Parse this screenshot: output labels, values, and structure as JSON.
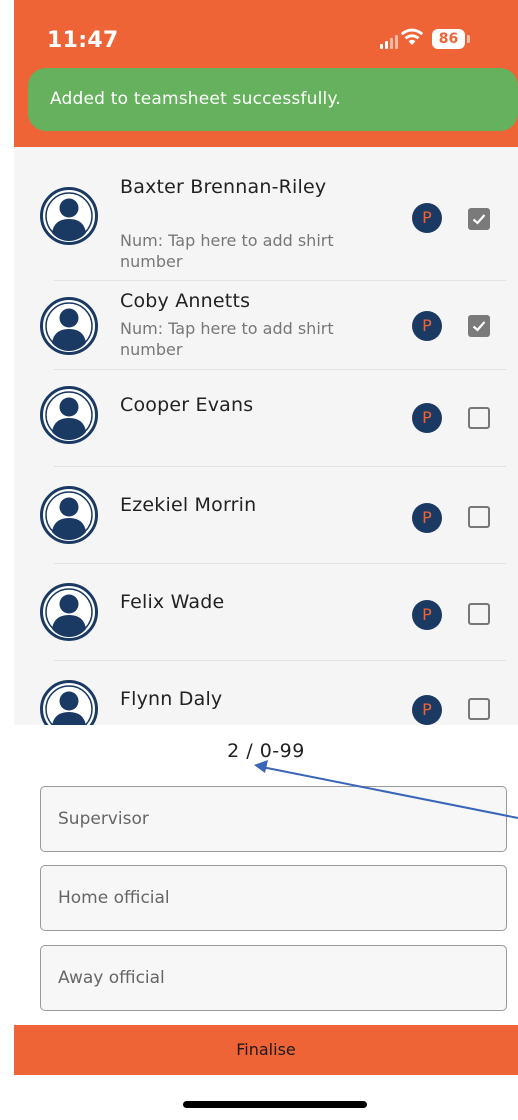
{
  "status_bar": {
    "time": "11:47",
    "battery": "86",
    "icons": [
      "signal-icon",
      "wifi-icon",
      "battery-icon"
    ]
  },
  "toast": {
    "message": "Added to teamsheet successfully."
  },
  "players": [
    {
      "name": "Baxter Brennan-Riley",
      "number_hint": "Num: Tap here to add shirt number",
      "badge": "P",
      "checked": true
    },
    {
      "name": "Coby Annetts",
      "number_hint": "Num: Tap here to add shirt number",
      "badge": "P",
      "checked": true
    },
    {
      "name": "Cooper Evans",
      "number_hint": "",
      "badge": "P",
      "checked": false
    },
    {
      "name": "Ezekiel Morrin",
      "number_hint": "",
      "badge": "P",
      "checked": false
    },
    {
      "name": "Felix Wade",
      "number_hint": "",
      "badge": "P",
      "checked": false
    },
    {
      "name": "Flynn Daly",
      "number_hint": "",
      "badge": "P",
      "checked": false
    }
  ],
  "counter": {
    "text": "2 / 0-99"
  },
  "fields": {
    "supervisor_placeholder": "Supervisor",
    "home_official_placeholder": "Home official",
    "away_official_placeholder": "Away official"
  },
  "finalise_label": "Finalise",
  "colors": {
    "accent": "#ee6436",
    "toast": "#66b15e",
    "badge": "#1a3a64",
    "avatar": "#1a3a64",
    "arrow": "#3a66b8"
  }
}
